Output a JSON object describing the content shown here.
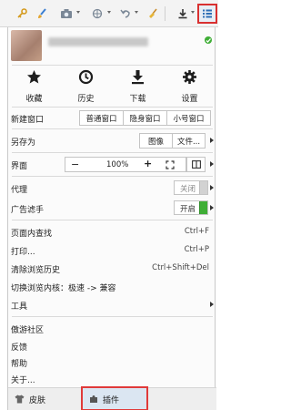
{
  "colors": {
    "highlight": "#e03a3a",
    "toggle_on": "#3fae36",
    "accent_blue": "#2f6fb5"
  },
  "toolbar": {
    "icons": [
      "key-icon",
      "paintbrush-icon",
      "camera-icon",
      "translate-icon",
      "undo-icon",
      "broom-icon",
      "download-icon",
      "menu-icon"
    ]
  },
  "profile": {
    "sync_icon": "sync-icon"
  },
  "quick_actions": [
    {
      "label": "收藏",
      "icon": "star-icon"
    },
    {
      "label": "历史",
      "icon": "clock-icon"
    },
    {
      "label": "下载",
      "icon": "download-icon"
    },
    {
      "label": "设置",
      "icon": "gear-icon"
    }
  ],
  "menu": {
    "new_window": {
      "label": "新建窗口",
      "normal": "普通窗口",
      "private": "隐身窗口",
      "small": "小号窗口"
    },
    "save_as": {
      "label": "另存为",
      "image": "图像",
      "file": "文件..."
    },
    "interface": {
      "label": "界面",
      "minus": "−",
      "zoom": "100%",
      "plus": "+"
    },
    "proxy": {
      "label": "代理",
      "state": "关闭",
      "on": false
    },
    "ad_filter": {
      "label": "广告滤手",
      "state": "开启",
      "on": true
    },
    "find": {
      "label": "页面内查找",
      "shortcut": "Ctrl+F"
    },
    "print": {
      "label": "打印...",
      "shortcut": "Ctrl+P"
    },
    "clear_history": {
      "label": "清除浏览历史",
      "shortcut": "Ctrl+Shift+Del"
    },
    "switch_core": {
      "label": "切换浏览内核：极速 -> 兼容"
    },
    "tools": {
      "label": "工具"
    },
    "community": {
      "label": "傲游社区"
    },
    "feedback": {
      "label": "反馈"
    },
    "help": {
      "label": "帮助"
    },
    "about": {
      "label": "关于..."
    }
  },
  "bottom": {
    "skin": "皮肤",
    "plugin": "插件"
  }
}
